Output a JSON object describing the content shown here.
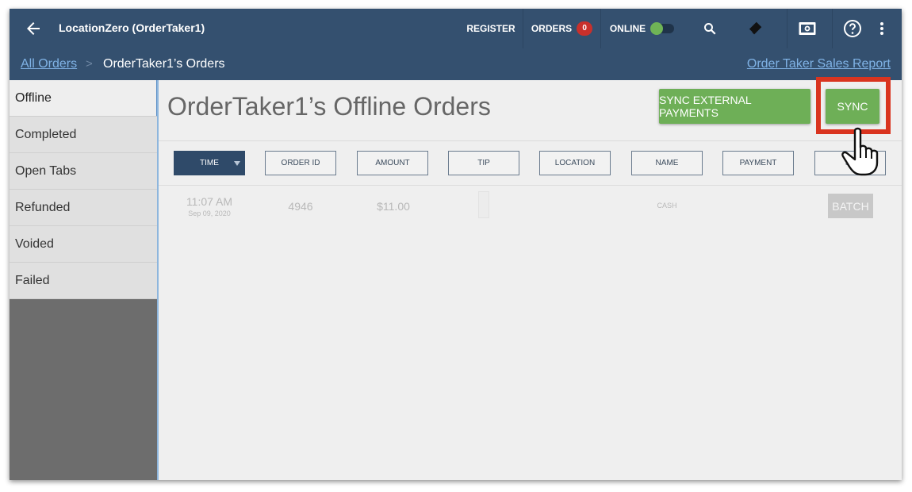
{
  "app": {
    "title": "LocationZero (OrderTaker1)"
  },
  "nav": {
    "register": "REGISTER",
    "orders": "ORDERS",
    "orders_badge": "0",
    "online": "ONLINE"
  },
  "breadcrumb": {
    "root": "All Orders",
    "separator": ">",
    "current": "OrderTaker1’s Orders",
    "report_link": "Order Taker Sales Report"
  },
  "sidebar": {
    "items": [
      {
        "label": "Offline"
      },
      {
        "label": "Completed"
      },
      {
        "label": "Open Tabs"
      },
      {
        "label": "Refunded"
      },
      {
        "label": "Voided"
      },
      {
        "label": "Failed"
      }
    ]
  },
  "main": {
    "title": "OrderTaker1’s Offline Orders",
    "sync_external_label": "SYNC EXTERNAL PAYMENTS",
    "sync_label": "SYNC",
    "columns": [
      "TIME",
      "ORDER ID",
      "AMOUNT",
      "TIP",
      "LOCATION",
      "NAME",
      "PAYMENT",
      "ST"
    ],
    "rows": [
      {
        "time": "11:07 AM",
        "date": "Sep 09, 2020",
        "order_id": "4946",
        "amount": "$11.00",
        "name": "CASH",
        "status_button": "BATCH"
      }
    ]
  },
  "colors": {
    "header_bg": "#34506f",
    "accent_green": "#6eaf57",
    "badge_red": "#c9302c",
    "highlight_red": "#d9341f",
    "link_blue": "#7fb2e5"
  },
  "icons": [
    "back-arrow-icon",
    "search-icon",
    "eraser-icon",
    "cash-drawer-icon",
    "help-icon",
    "more-vert-icon",
    "pointing-hand-icon"
  ]
}
